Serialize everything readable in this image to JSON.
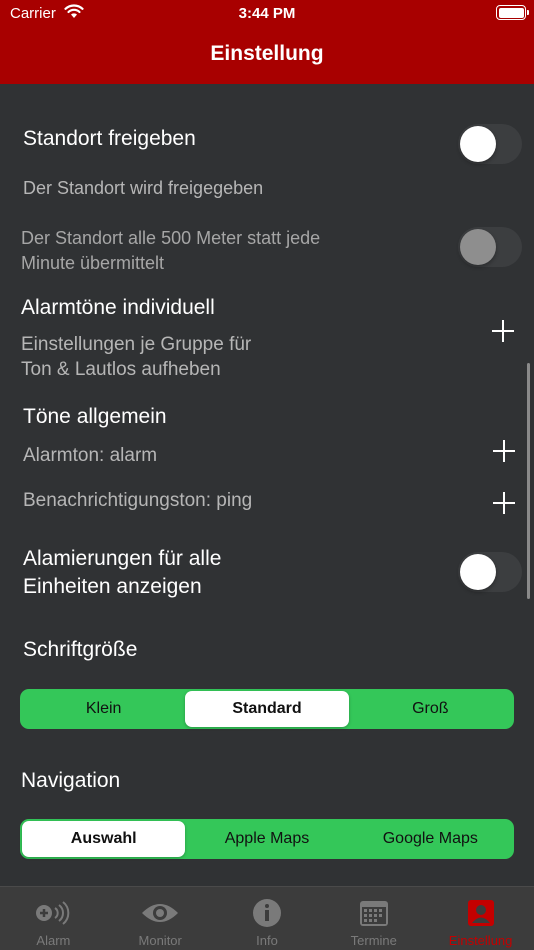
{
  "status_bar": {
    "carrier": "Carrier",
    "time": "3:44 PM"
  },
  "nav": {
    "title": "Einstellung"
  },
  "settings": {
    "location_share": {
      "label": "Standort freigeben",
      "enabled": false
    },
    "location_status": "Der Standort wird freigegeben",
    "location_500m": {
      "label_line1": "Der Standort alle 500 Meter statt jede",
      "label_line2": "Minute übermittelt",
      "enabled": false,
      "disabled": true
    },
    "alarm_tones_individual": {
      "label": "Alarmtöne  individuell",
      "desc_line1": "Einstellungen je Gruppe für",
      "desc_line2": "Ton & Lautlos aufheben"
    },
    "tones_general": {
      "label": "Töne allgemein",
      "alarm_tone": "Alarmton: alarm",
      "notification_tone": "Benachrichtigungston: ping"
    },
    "show_all_units": {
      "label_line1": "Alamierungen für alle",
      "label_line2": "Einheiten anzeigen",
      "enabled": false
    },
    "font_size": {
      "label": "Schriftgröße",
      "options": [
        "Klein",
        "Standard",
        "Groß"
      ],
      "selected": "Standard"
    },
    "navigation": {
      "label": "Navigation",
      "options": [
        "Auswahl",
        "Apple Maps",
        "Google Maps"
      ],
      "selected": "Auswahl"
    }
  },
  "tabbar": {
    "items": [
      {
        "label": "Alarm",
        "icon": "alarm-signal-icon"
      },
      {
        "label": "Monitor",
        "icon": "eye-icon"
      },
      {
        "label": "Info",
        "icon": "info-icon"
      },
      {
        "label": "Termine",
        "icon": "calendar-icon"
      },
      {
        "label": "Einstellung",
        "icon": "person-badge-icon"
      }
    ],
    "active": "Einstellung"
  },
  "colors": {
    "brand_red": "#a80000",
    "background": "#303234",
    "segment_green": "#34c759",
    "active_tab": "#c40000"
  }
}
